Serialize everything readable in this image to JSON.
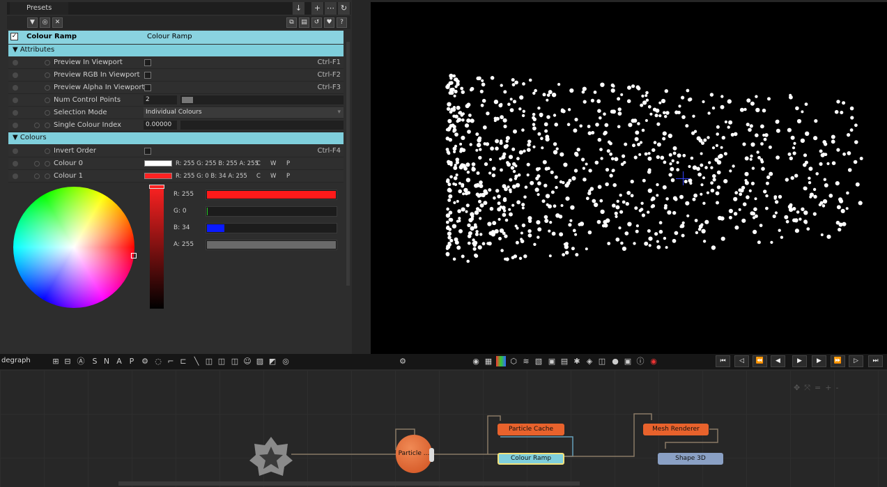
{
  "presets": {
    "tab_label": "Presets"
  },
  "node_header": {
    "name": "Colour Ramp",
    "type": "Colour Ramp"
  },
  "sections": {
    "attributes": "Attributes",
    "colours": "Colours"
  },
  "attributes": [
    {
      "label": "Preview In Viewport",
      "shortcut": "Ctrl-F1"
    },
    {
      "label": "Preview RGB In Viewport",
      "shortcut": "Ctrl-F2"
    },
    {
      "label": "Preview Alpha In Viewport",
      "shortcut": "Ctrl-F3"
    },
    {
      "label": "Num Control Points",
      "value": "2"
    },
    {
      "label": "Selection Mode",
      "value": "Individual Colours"
    },
    {
      "label": "Single Colour Index",
      "value": "0.00000"
    }
  ],
  "colours": {
    "invert": {
      "label": "Invert Order",
      "shortcut": "Ctrl-F4"
    },
    "c0": {
      "label": "Colour 0",
      "value": "R: 255 G: 255 B: 255 A: 255",
      "swatch": "#ffffff"
    },
    "c1": {
      "label": "Colour 1",
      "value": "R: 255 G: 0 B: 34 A: 255",
      "swatch": "#ff2222"
    },
    "cwp": [
      "C",
      "W",
      "P"
    ]
  },
  "sliders": [
    {
      "label": "R: 255",
      "fraction": 1.0,
      "color": "#ff1a1a"
    },
    {
      "label": "G: 0",
      "fraction": 0.0,
      "color": "#22cc22"
    },
    {
      "label": "B: 34",
      "fraction": 0.133,
      "color": "#0a1aff"
    },
    {
      "label": "A: 255",
      "fraction": 1.0,
      "color": "#6a6a6a"
    }
  ],
  "toolbar": {
    "graph_label": "degraph",
    "snap_letters": [
      "S",
      "N",
      "A",
      "P"
    ]
  },
  "nodes": {
    "particle": "Particle ...",
    "particle_cache": "Particle Cache",
    "colour_ramp": "Colour Ramp",
    "mesh_renderer": "Mesh Renderer",
    "shape3d": "Shape 3D"
  },
  "graph_controls": [
    "+",
    "-"
  ]
}
